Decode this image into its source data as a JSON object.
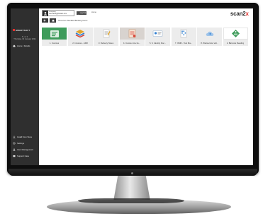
{
  "sidebar": {
    "brand_text": "SMARTSOFT",
    "date_line1": "hi, sv 3",
    "date_line2": "Thursday, 02 January 2021",
    "home_label": "Home / Details",
    "bottom_items": [
      {
        "label": "Install from Store",
        "icon": "download-icon"
      },
      {
        "label": "Settings",
        "icon": "gear-icon"
      },
      {
        "label": "User Management",
        "icon": "user-icon"
      },
      {
        "label": "Support Case",
        "icon": "support-icon"
      }
    ]
  },
  "header": {
    "user_line1": "Company",
    "user_line2": "username@domain.com",
    "logout_label": "Log Out",
    "top_link": "Home",
    "logo_word": "scan2",
    "logo_accent": "x",
    "breadcrumb": "Inbox/xxx Starfield Banking Items"
  },
  "tiles": [
    {
      "label": "1. Invoices",
      "style": "active",
      "icon": "invoice-icon"
    },
    {
      "label": "2. Invoices - ADR",
      "style": "plain",
      "icon": "stack-icon"
    },
    {
      "label": "3. Delivery Notes",
      "style": "plain",
      "icon": "notepad-icon"
    },
    {
      "label": "4. Invoice Line Ite...",
      "style": "pinned",
      "icon": "invoice-lines-icon"
    },
    {
      "label": "5. 6. Identity Doc...",
      "style": "plain",
      "icon": "id-card-icon"
    },
    {
      "label": "7. OMR - Test Ma...",
      "style": "plain",
      "icon": "omr-sheet-icon"
    },
    {
      "label": "8. Webservice Val...",
      "style": "plain",
      "icon": "cloud-sync-icon"
    },
    {
      "label": "9. Barcode Reading",
      "style": "light",
      "icon": "barcode-tag-icon"
    }
  ],
  "colors": {
    "sidebar_bg": "#2f2f2f",
    "accent_green": "#3f9c5b",
    "brand_red": "#e2322e"
  }
}
